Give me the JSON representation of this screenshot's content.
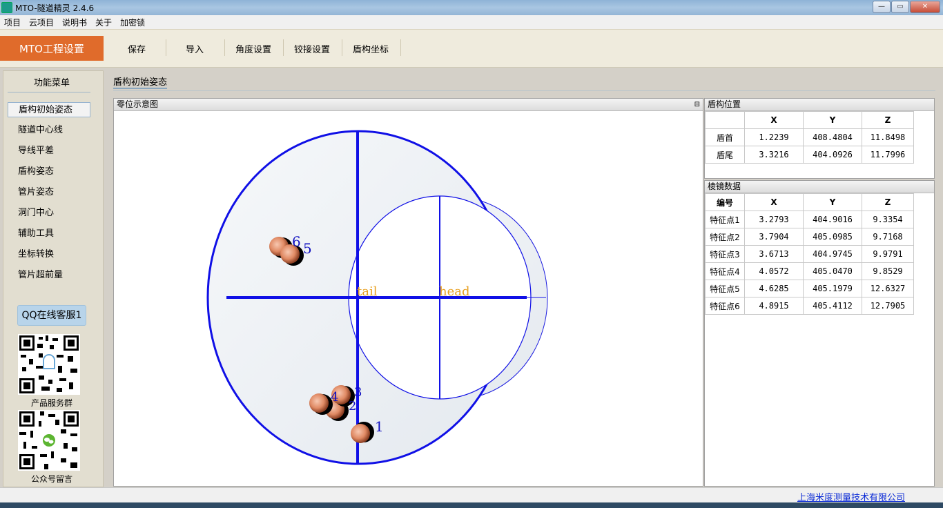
{
  "window": {
    "title": "MTO-隧道精灵 2.4.6",
    "minimize": "—",
    "maximize": "▭",
    "close": "✕"
  },
  "menubar": [
    "项目",
    "云项目",
    "说明书",
    "关于",
    "加密锁"
  ],
  "toolbar": {
    "main_button": "MTO工程设置",
    "buttons": [
      "保存",
      "导入",
      "角度设置",
      "铰接设置",
      "盾构坐标"
    ]
  },
  "sidebar": {
    "title": "功能菜单",
    "items": [
      "盾构初始姿态",
      "隧道中心线",
      "导线平差",
      "盾构姿态",
      "管片姿态",
      "洞门中心",
      "辅助工具",
      "坐标转换",
      "管片超前量"
    ],
    "active_index": 0,
    "qq_button": "QQ在线客服1",
    "qr1_label": "产品服务群",
    "qr2_label": "公众号留言"
  },
  "main": {
    "tab": "盾构初始姿态"
  },
  "diagram": {
    "title": "零位示意图",
    "tail_label": "tail",
    "head_label": "head",
    "point_labels": [
      "1",
      "2",
      "3",
      "4",
      "5",
      "6"
    ]
  },
  "shield_position": {
    "title": "盾构位置",
    "columns": [
      "",
      "X",
      "Y",
      "Z"
    ],
    "rows": [
      [
        "盾首",
        "1.2239",
        "408.4804",
        "11.8498"
      ],
      [
        "盾尾",
        "3.3216",
        "404.0926",
        "11.7996"
      ]
    ]
  },
  "survey_data": {
    "title": "棱镜数据",
    "columns": [
      "编号",
      "X",
      "Y",
      "Z"
    ],
    "rows": [
      [
        "特征点1",
        "3.2793",
        "404.9016",
        "9.3354"
      ],
      [
        "特征点2",
        "3.7904",
        "405.0985",
        "9.7168"
      ],
      [
        "特征点3",
        "3.6713",
        "404.9745",
        "9.9791"
      ],
      [
        "特征点4",
        "4.0572",
        "405.0470",
        "9.8529"
      ],
      [
        "特征点5",
        "4.6285",
        "405.1979",
        "12.6327"
      ],
      [
        "特征点6",
        "4.8915",
        "405.4112",
        "12.7905"
      ]
    ]
  },
  "statusbar": {
    "company": "上海米度测量技术有限公司"
  }
}
